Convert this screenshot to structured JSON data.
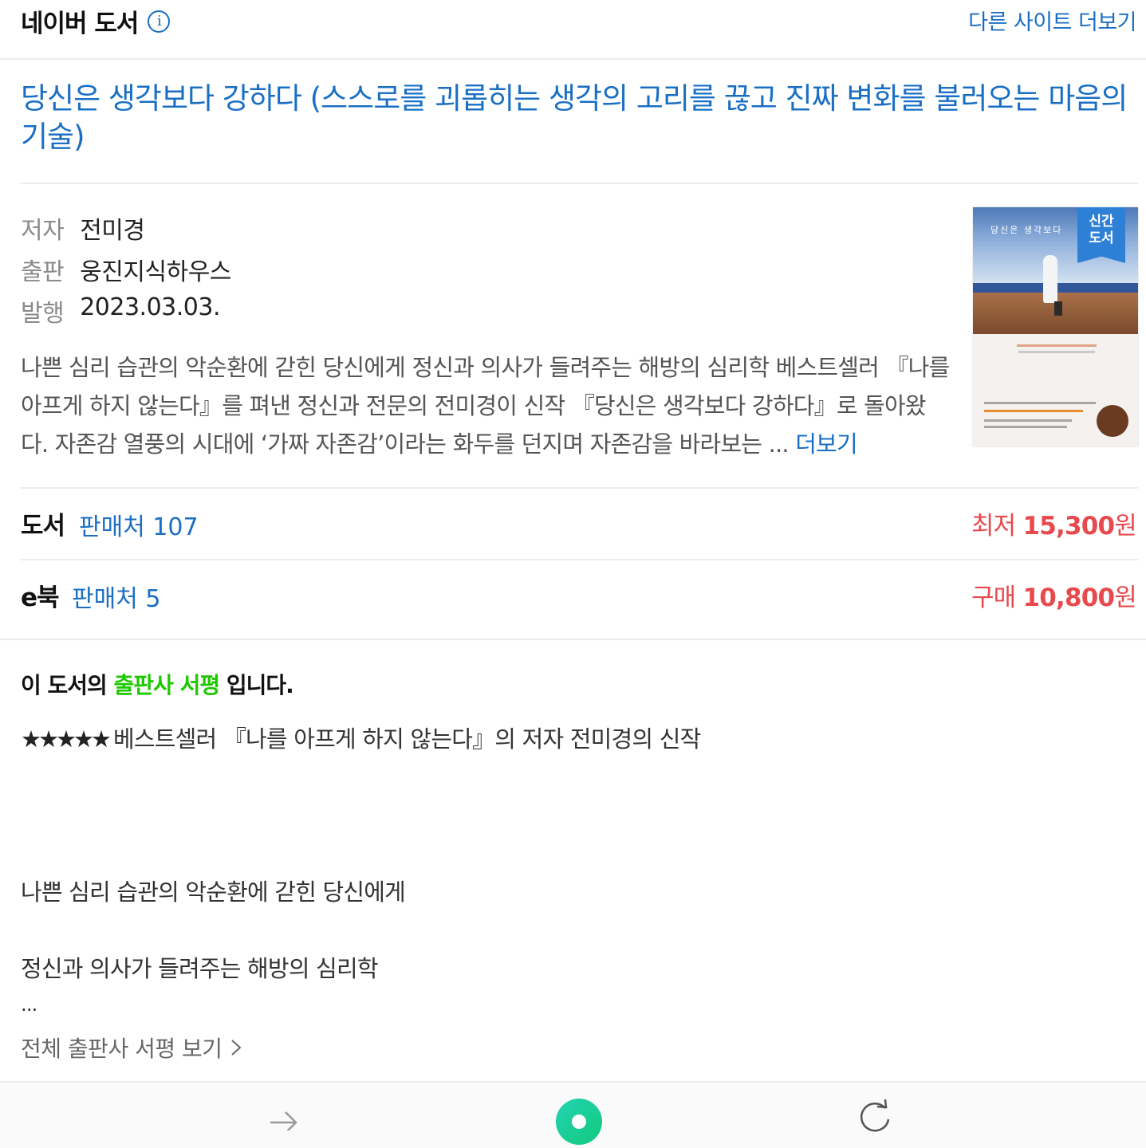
{
  "header": {
    "brand": "네이버 도서",
    "info_icon": "info-icon",
    "more_sites": "다른 사이트 더보기"
  },
  "book": {
    "title": "당신은 생각보다 강하다 (스스로를 괴롭히는 생각의 고리를 끊고 진짜 변화를 불러오는 마음의 기술)",
    "author_label": "저자",
    "author": "전미경",
    "publisher_label": "출판",
    "publisher": "웅진지식하우스",
    "date_label": "발행",
    "date": "2023.03.03.",
    "description": "나쁜 심리 습관의 악순환에 갇힌 당신에게 정신과 의사가 들려주는 해방의 심리학 베스트셀러 『나를 아프게 하지 않는다』를 펴낸 정신과 전문의 전미경이 신작 『당신은 생각보다 강하다』로 돌아왔다. 자존감 열풍의 시대에 ‘가짜 자존감’이라는 화두를 던지며 자존감을 바라보는 ... ",
    "more": "더보기",
    "cover": {
      "title_text": "당신은  생각보다",
      "badge": "신간\n도서"
    }
  },
  "prices": {
    "book": {
      "label": "도서",
      "stores": "판매처 107",
      "price_prefix": "최저 ",
      "price": "15,300",
      "currency": "원"
    },
    "ebook": {
      "label": "e북",
      "stores": "판매처 5",
      "price_prefix": "구매 ",
      "price": "10,800",
      "currency": "원"
    }
  },
  "review": {
    "head_pre": "이 도서의 ",
    "head_highlight": "출판사 서평",
    "head_post": " 입니다.",
    "stars": "★★★★★",
    "line1": "베스트셀러 『나를 아프게 하지 않는다』의 저자 전미경의 신작",
    "line2": "나쁜 심리 습관의 악순환에 갇힌 당신에게",
    "line3": "정신과 의사가 들려주는 해방의 심리학",
    "ellipsis": "...",
    "full_link": "전체 출판사 서평 보기",
    "full_link_icon": "chevron-right-icon"
  },
  "colors": {
    "link": "#1a6fc4",
    "price": "#e8494d",
    "highlight": "#1ec800",
    "home": "#10c97c"
  },
  "toolbar": {
    "forward_icon": "arrow-right-icon",
    "home_icon": "naver-home-icon",
    "reload_icon": "reload-icon"
  }
}
